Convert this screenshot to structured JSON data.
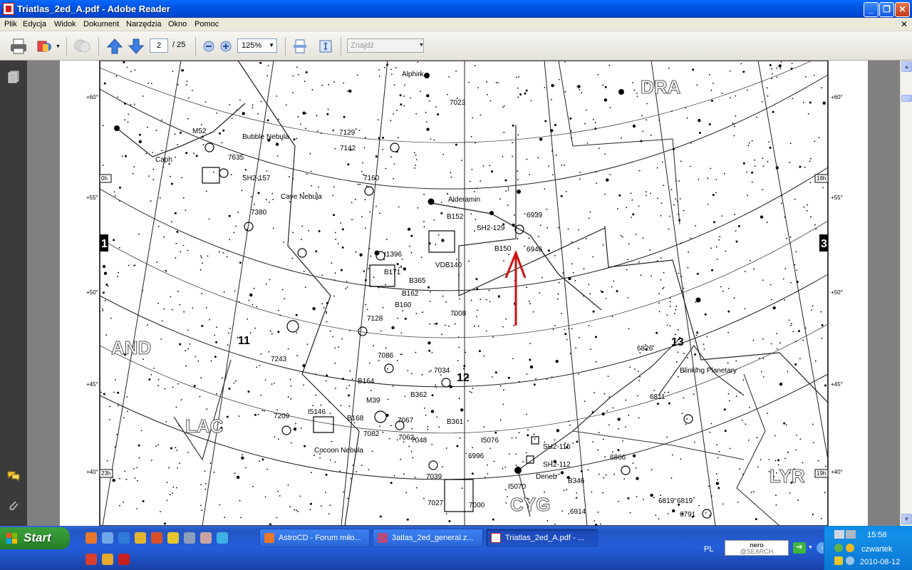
{
  "window": {
    "title": "Triatlas_2ed_A.pdf - Adobe Reader",
    "controls": [
      "minimize",
      "restore",
      "close"
    ]
  },
  "menu": {
    "items": [
      "Plik",
      "Edycja",
      "Widok",
      "Dokument",
      "Narzędzia",
      "Okno",
      "Pomoc"
    ]
  },
  "toolbar": {
    "page_current": "2",
    "page_total": "/ 25",
    "zoom": "125%",
    "find_placeholder": "Znajdź"
  },
  "chart": {
    "constellations": [
      "DRA",
      "AND",
      "LAC",
      "LYR",
      "CYG"
    ],
    "section_numbers": [
      "1",
      "3",
      "11",
      "12",
      "13"
    ],
    "dec_labels_left": [
      "+60°",
      "+55°",
      "+50°",
      "+45°",
      "+40°"
    ],
    "dec_labels_right": [
      "+60°",
      "+55°",
      "+50°",
      "+45°",
      "+40°"
    ],
    "ra_labels": [
      "0h",
      "18h",
      "23h",
      "19h"
    ],
    "objects": [
      "Alphirk",
      "M52",
      "Bubble Nebula",
      "Caph",
      "7635",
      "SH2-157",
      "Cave Nebula",
      "Alderamin",
      "B152",
      "SH2-129",
      "B150",
      "6939",
      "6946",
      "I1396",
      "B171",
      "B365",
      "B162",
      "B160",
      "VDB140",
      "7008",
      "7023",
      "M39",
      "B362",
      "B164",
      "B168",
      "Cocoon Nebula",
      "I5146",
      "B361",
      "I5076",
      "SH2-115",
      "SH2-112",
      "Deneb",
      "I5070",
      "B346",
      "6914",
      "6866",
      "6826",
      "6811",
      "Blinking Planetary",
      "7209",
      "7243",
      "7380",
      "7160",
      "7129",
      "7142",
      "7086",
      "7082",
      "7062",
      "7067",
      "7048",
      "7039",
      "7000",
      "7027",
      "6996",
      "7034",
      "6819",
      "6791",
      "6819",
      "7128"
    ],
    "annotation": "red-arrow"
  },
  "taskbar": {
    "start_label": "Start",
    "tasks": [
      {
        "label": "AstroCD - Forum miło...",
        "active": false
      },
      {
        "label": "3atlas_2ed_general.z...",
        "active": false
      },
      {
        "label": "Triatlas_2ed_A.pdf - ...",
        "active": true
      }
    ],
    "language": "PL",
    "search_brand": "nero",
    "search_sub": "@SEARCH",
    "clock": "15:58",
    "day": "czwartek",
    "date": "2010-08-12"
  },
  "colors": {
    "titlebar": "#0054e3",
    "menubar": "#ece9d8",
    "navpane": "#3b3b3b",
    "taskbar": "#245ddb",
    "start": "#2f8f2f",
    "arrow": "#d01010"
  }
}
